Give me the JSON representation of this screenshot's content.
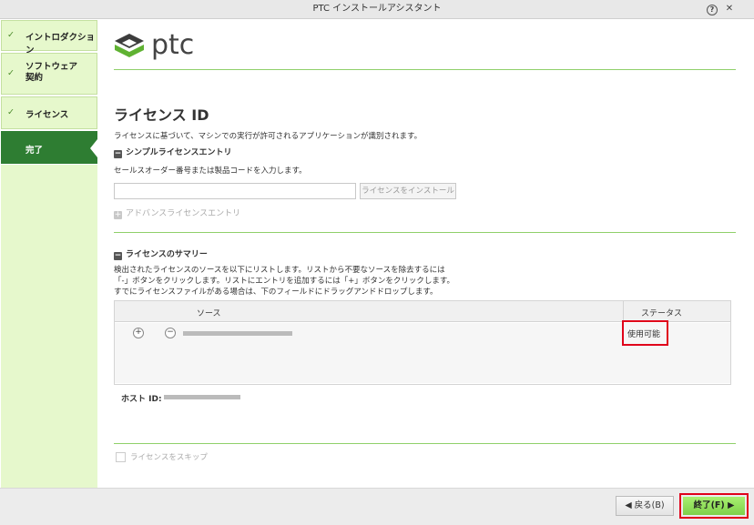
{
  "window": {
    "title": "PTC インストールアシスタント",
    "help_icon": "?",
    "close_icon": "✕"
  },
  "sidebar": {
    "items": [
      {
        "label": "イントロダクション",
        "check": "✓"
      },
      {
        "label": "ソフトウェア\n契約",
        "check": "✓"
      },
      {
        "label": "ライセンス",
        "check": "✓"
      },
      {
        "label": "完了",
        "check": ""
      }
    ]
  },
  "logo": {
    "text": "ptc"
  },
  "main": {
    "title": "ライセンス ID",
    "description": "ライセンスに基づいて、マシンでの実行が許可されるアプリケーションが識別されます。",
    "simple_entry": {
      "heading": "シンプルライセンスエントリ",
      "instruction": "セールスオーダー番号または製品コードを入力します。",
      "input_value": "",
      "install_button": "ライセンスをインストール"
    },
    "advanced_entry": {
      "heading": "アドバンスライセンスエントリ"
    },
    "summary": {
      "heading": "ライセンスのサマリー",
      "lines": [
        "検出されたライセンスのソースを以下にリストします。リストから不要なソースを除去するには",
        "「-」ボタンをクリックします。リストにエントリを追加するには「+」ボタンをクリックします。",
        "すでにライセンスファイルがある場合は、下のフィールドにドラッグアンドドロップします。"
      ],
      "columns": {
        "source": "ソース",
        "status": "ステータス"
      },
      "rows": [
        {
          "status": "使用可能"
        }
      ],
      "add_label": "+",
      "remove_label": "−",
      "host_id_label": "ホスト ID:"
    },
    "skip_license": {
      "label": "ライセンスをスキップ",
      "checked": false
    }
  },
  "footer": {
    "back_label": "◀ 戻る(B)",
    "finish_label": "終了(F) ▶"
  }
}
